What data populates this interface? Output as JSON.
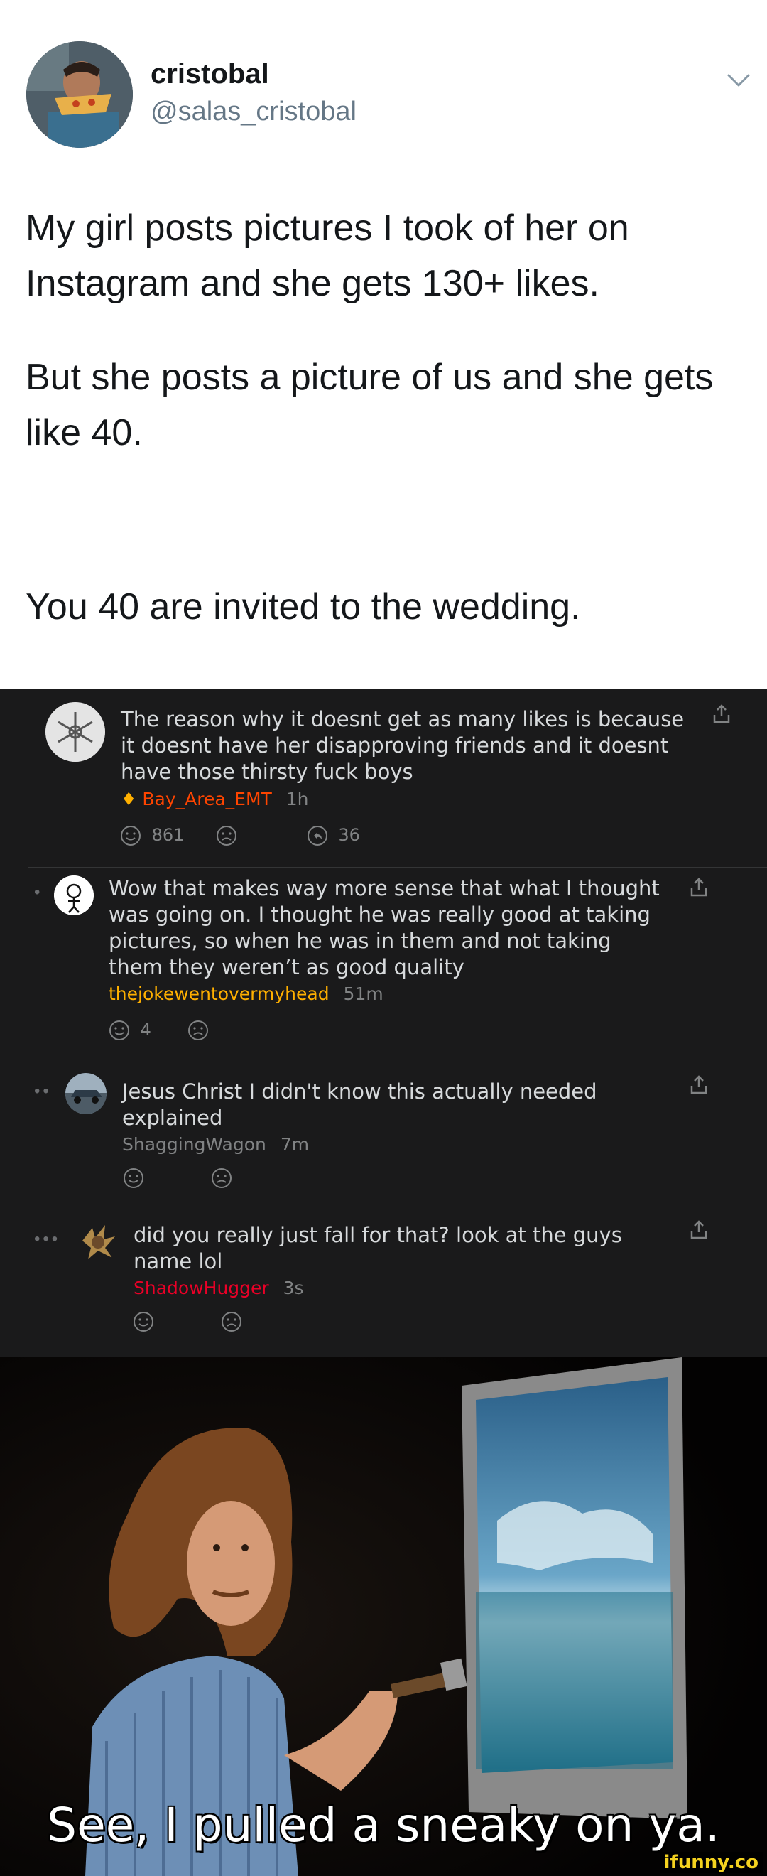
{
  "tweet": {
    "name": "cristobal",
    "handle": "@salas_cristobal",
    "line1": "My girl posts pictures I took of her on Instagram and she gets 130+ likes.",
    "line2": "But she posts a picture of us and she gets like 40.",
    "line3": "You 40 are invited to the wedding."
  },
  "comments": [
    {
      "text": "The reason why it doesnt get as many likes is because it doesnt have her disapproving friends and it doesnt have those thirsty fuck boys",
      "user": "Bay_Area_EMT",
      "time": "1h",
      "upvotes": "861",
      "replies": "36",
      "user_color": "#ff4500"
    },
    {
      "text": "Wow that makes way more sense that what I thought was going on. I thought he was really good at taking pictures, so when he was in them and not taking them they weren’t as good quality",
      "user": "thejokewentovermyhead",
      "time": "51m",
      "upvotes": "4",
      "user_color": "#ffb000"
    },
    {
      "text": "Jesus Christ I didn't know this actually needed explained",
      "user": "ShaggingWagon",
      "time": "7m",
      "user_color": "#818384"
    },
    {
      "text": "did you really just fall for that? look at the guys name lol",
      "user": "ShadowHugger",
      "time": "3s",
      "user_color": "#ea0027"
    }
  ],
  "meme": {
    "caption": "See, I pulled a sneaky on ya."
  },
  "watermark": "ifunny.co",
  "colors": {
    "tweet_bg": "#ffffff",
    "comments_bg": "#1a1a1b",
    "meme_caption": "#ffffff",
    "watermark": "#f4d21f"
  }
}
